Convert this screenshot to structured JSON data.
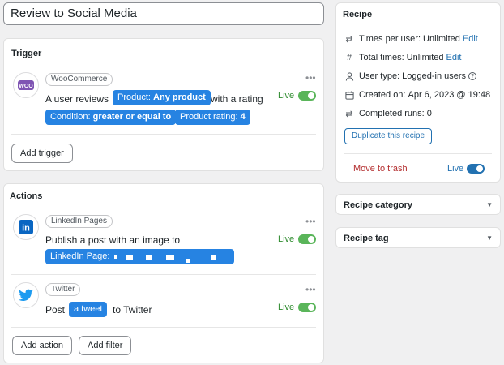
{
  "recipe_title": "Review to Social Media",
  "trigger": {
    "heading": "Trigger",
    "integration": "WooCommerce",
    "icon_label": "WOO",
    "sentence_start": "A user reviews",
    "product_token": {
      "label": "Product:",
      "value": "Any product"
    },
    "sentence_mid": "with a rating",
    "condition_token": {
      "label": "Condition:",
      "value": "greater or equal to"
    },
    "rating_token": {
      "label": "Product rating:",
      "value": "4"
    },
    "live_label": "Live",
    "add_button": "Add trigger"
  },
  "actions": {
    "heading": "Actions",
    "items": [
      {
        "integration": "LinkedIn Pages",
        "icon_label": "in",
        "sentence": "Publish a post with an image to",
        "token_label": "LinkedIn Page:",
        "live_label": "Live"
      },
      {
        "integration": "Twitter",
        "sentence_start": "Post",
        "token": "a tweet",
        "sentence_end": "to Twitter",
        "live_label": "Live"
      }
    ],
    "add_action_button": "Add action",
    "add_filter_button": "Add filter"
  },
  "sidebar": {
    "recipe_heading": "Recipe",
    "times_per_user": {
      "label": "Times per user:",
      "value": "Unlimited",
      "edit": "Edit"
    },
    "total_times": {
      "label": "Total times:",
      "value": "Unlimited",
      "edit": "Edit"
    },
    "user_type": {
      "label": "User type:",
      "value": "Logged-in users"
    },
    "created_on": {
      "label": "Created on:",
      "value": "Apr 6, 2023 @ 19:48"
    },
    "completed_runs": {
      "label": "Completed runs:",
      "value": "0"
    },
    "duplicate_button": "Duplicate this recipe",
    "trash_link": "Move to trash",
    "live_label": "Live",
    "category_heading": "Recipe category",
    "tag_heading": "Recipe tag"
  },
  "colors": {
    "token": "#2683e2",
    "live_green": "#2e8b2e",
    "link_blue": "#2271b1",
    "trash_red": "#b32d2e",
    "woo_purple": "#7f54b3",
    "linkedin": "#0a66c2",
    "twitter": "#1d9bf0"
  }
}
